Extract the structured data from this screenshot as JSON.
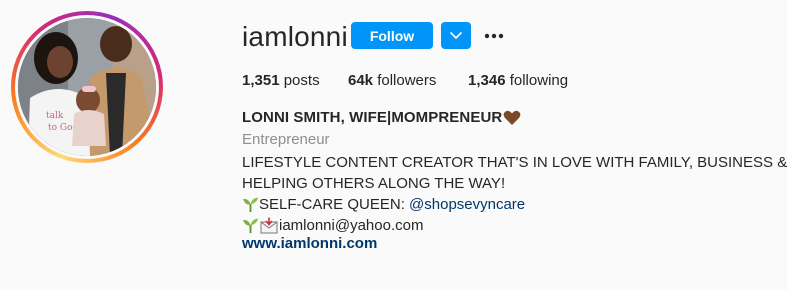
{
  "profile": {
    "username": "iamlonni",
    "follow_label": "Follow",
    "stats": {
      "posts_count": "1,351",
      "posts_label": "posts",
      "followers_count": "64k",
      "followers_label": "followers",
      "following_count": "1,346",
      "following_label": "following"
    },
    "full_name": "LONNI SMITH, WIFE|MOMPRENEUR",
    "category": "Entrepreneur",
    "bio": {
      "line1": "LIFESTYLE CONTENT CREATOR THAT'S IN LOVE WITH FAMILY, BUSINESS &",
      "line2": "HELPING OTHERS ALONG THE WAY!",
      "line3_prefix": "SELF-CARE QUEEN: ",
      "line3_mention": "@shopsevyncare",
      "line4": "iamlonni@yahoo.com"
    },
    "website": "www.iamlonni.com"
  },
  "icons": {
    "dropdown": "chevron-down-icon",
    "more": "more-options-icon",
    "heart": "brown-heart-emoji",
    "seedling": "seedling-emoji",
    "mail": "envelope-with-arrow-emoji"
  },
  "colors": {
    "accent": "#0095f6",
    "link": "#00376b",
    "muted": "#8e8e8e"
  }
}
